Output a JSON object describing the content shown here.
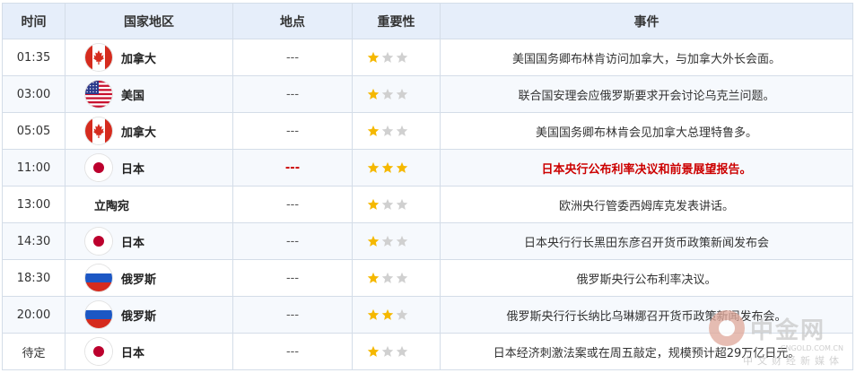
{
  "headers": {
    "time": "时间",
    "country": "国家地区",
    "place": "地点",
    "importance": "重要性",
    "event": "事件"
  },
  "colors": {
    "star_on": "#f5b800",
    "star_off": "#d0d0d0",
    "highlight": "#cc0000",
    "header_bg": "#e6eefa"
  },
  "rows": [
    {
      "time": "01:35",
      "country": "加拿大",
      "flag": "canada-flag-icon",
      "place": "---",
      "stars": 1,
      "event": "美国国务卿布林肯访问加拿大，与加拿大外长会面。",
      "highlight": false
    },
    {
      "time": "03:00",
      "country": "美国",
      "flag": "usa-flag-icon",
      "place": "---",
      "stars": 1,
      "event": "联合国安理会应俄罗斯要求开会讨论乌克兰问题。",
      "highlight": false
    },
    {
      "time": "05:05",
      "country": "加拿大",
      "flag": "canada-flag-icon",
      "place": "---",
      "stars": 1,
      "event": "美国国务卿布林肯会见加拿大总理特鲁多。",
      "highlight": false
    },
    {
      "time": "11:00",
      "country": "日本",
      "flag": "japan-flag-icon",
      "place": "---",
      "stars": 3,
      "event": "日本央行公布利率决议和前景展望报告。",
      "highlight": true
    },
    {
      "time": "13:00",
      "country": "立陶宛",
      "flag": "",
      "place": "---",
      "stars": 1,
      "event": "欧洲央行管委西姆库克发表讲话。",
      "highlight": false
    },
    {
      "time": "14:30",
      "country": "日本",
      "flag": "japan-flag-icon",
      "place": "---",
      "stars": 1,
      "event": "日本央行行长黑田东彦召开货币政策新闻发布会",
      "highlight": false
    },
    {
      "time": "18:30",
      "country": "俄罗斯",
      "flag": "russia-flag-icon",
      "place": "---",
      "stars": 1,
      "event": "俄罗斯央行公布利率决议。",
      "highlight": false
    },
    {
      "time": "20:00",
      "country": "俄罗斯",
      "flag": "russia-flag-icon",
      "place": "---",
      "stars": 2,
      "event": "俄罗斯央行行长纳比乌琳娜召开货币政策新闻发布会。",
      "highlight": false
    },
    {
      "time": "待定",
      "country": "日本",
      "flag": "japan-flag-icon",
      "place": "---",
      "stars": 1,
      "event": "日本经济刺激法案或在周五敲定，规模预计超29万亿日元。",
      "highlight": false
    }
  ],
  "watermark": {
    "name": "中金网",
    "url": "CNGOLD.COM.CN",
    "tagline": "中文财经新媒体"
  }
}
